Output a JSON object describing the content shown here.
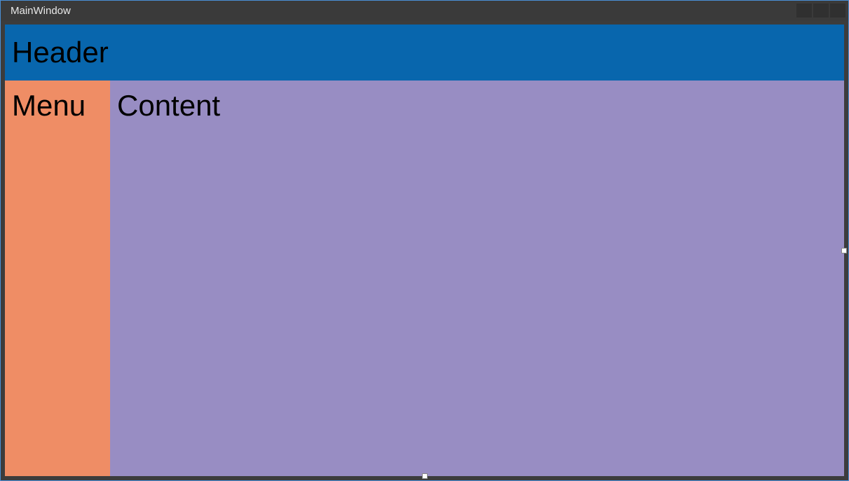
{
  "window": {
    "title": "MainWindow"
  },
  "layout": {
    "header_label": "Header",
    "menu_label": "Menu",
    "content_label": "Content"
  },
  "colors": {
    "header_bg": "#0866ad",
    "menu_bg": "#ef8d65",
    "content_bg": "#988dc3"
  }
}
